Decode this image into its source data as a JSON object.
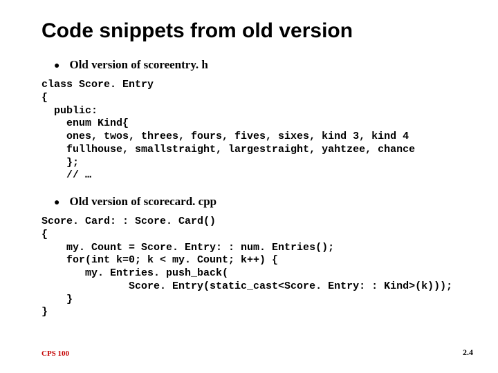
{
  "title": "Code snippets from old version",
  "bullet1": "Old version of scoreentry. h",
  "code1": "class Score. Entry\n{\n  public:\n    enum Kind{\n    ones, twos, threes, fours, fives, sixes, kind 3, kind 4\n    fullhouse, smallstraight, largestraight, yahtzee, chance\n    };\n    // …",
  "bullet2": "Old version of scorecard. cpp",
  "code2": "Score. Card: : Score. Card()\n{\n    my. Count = Score. Entry: : num. Entries();\n    for(int k=0; k < my. Count; k++) {\n       my. Entries. push_back(\n              Score. Entry(static_cast<Score. Entry: : Kind>(k)));\n    }\n}",
  "footer_left": "CPS 100",
  "footer_right": "2.4"
}
